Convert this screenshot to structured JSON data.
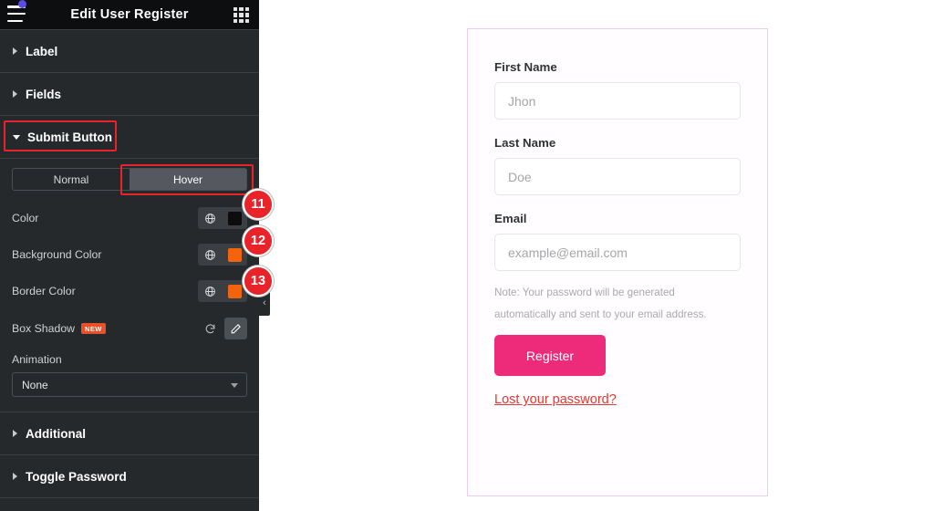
{
  "panel": {
    "title": "Edit User Register",
    "menu_icon": "hamburger-icon",
    "apps_icon": "grid-icon",
    "sections": [
      {
        "label": "Label",
        "state": "collapsed"
      },
      {
        "label": "Fields",
        "state": "collapsed"
      },
      {
        "label": "Submit Button",
        "state": "expanded",
        "highlighted": true
      },
      {
        "label": "Additional",
        "state": "collapsed"
      },
      {
        "label": "Toggle Password",
        "state": "collapsed"
      }
    ],
    "submit_button": {
      "tabs": [
        {
          "label": "Normal",
          "active": false
        },
        {
          "label": "Hover",
          "active": true,
          "highlighted": true
        }
      ],
      "controls": [
        {
          "label": "Color",
          "swatch": "#0d0d0d",
          "step": "11"
        },
        {
          "label": "Background Color",
          "swatch": "#f2650d",
          "step": "12"
        },
        {
          "label": "Border Color",
          "swatch": "#f2650d",
          "step": "13"
        }
      ],
      "box_shadow": {
        "label": "Box Shadow",
        "badge": "NEW",
        "reset_icon": "reset-icon",
        "edit_icon": "pencil-icon"
      },
      "animation": {
        "label": "Animation",
        "value": "None"
      }
    },
    "collapse_arrow": "‹"
  },
  "preview_form": {
    "fields": [
      {
        "label": "First Name",
        "placeholder": "Jhon",
        "value": ""
      },
      {
        "label": "Last Name",
        "placeholder": "Doe",
        "value": ""
      },
      {
        "label": "Email",
        "placeholder": "example@email.com",
        "value": ""
      }
    ],
    "note_line_1": "Note: Your password will be generated",
    "note_line_2": "automatically and sent to your email address.",
    "submit_label": "Register",
    "lost_password_label": "Lost your password?"
  },
  "colors": {
    "panel_bg": "#26292c",
    "panel_header_bg": "#0d0e0f",
    "accent_red": "#e8232a",
    "badge_orange": "#e8502a",
    "register_pink": "#ee2a7b",
    "link_red": "#e3372f",
    "card_border": "#eccdee"
  }
}
